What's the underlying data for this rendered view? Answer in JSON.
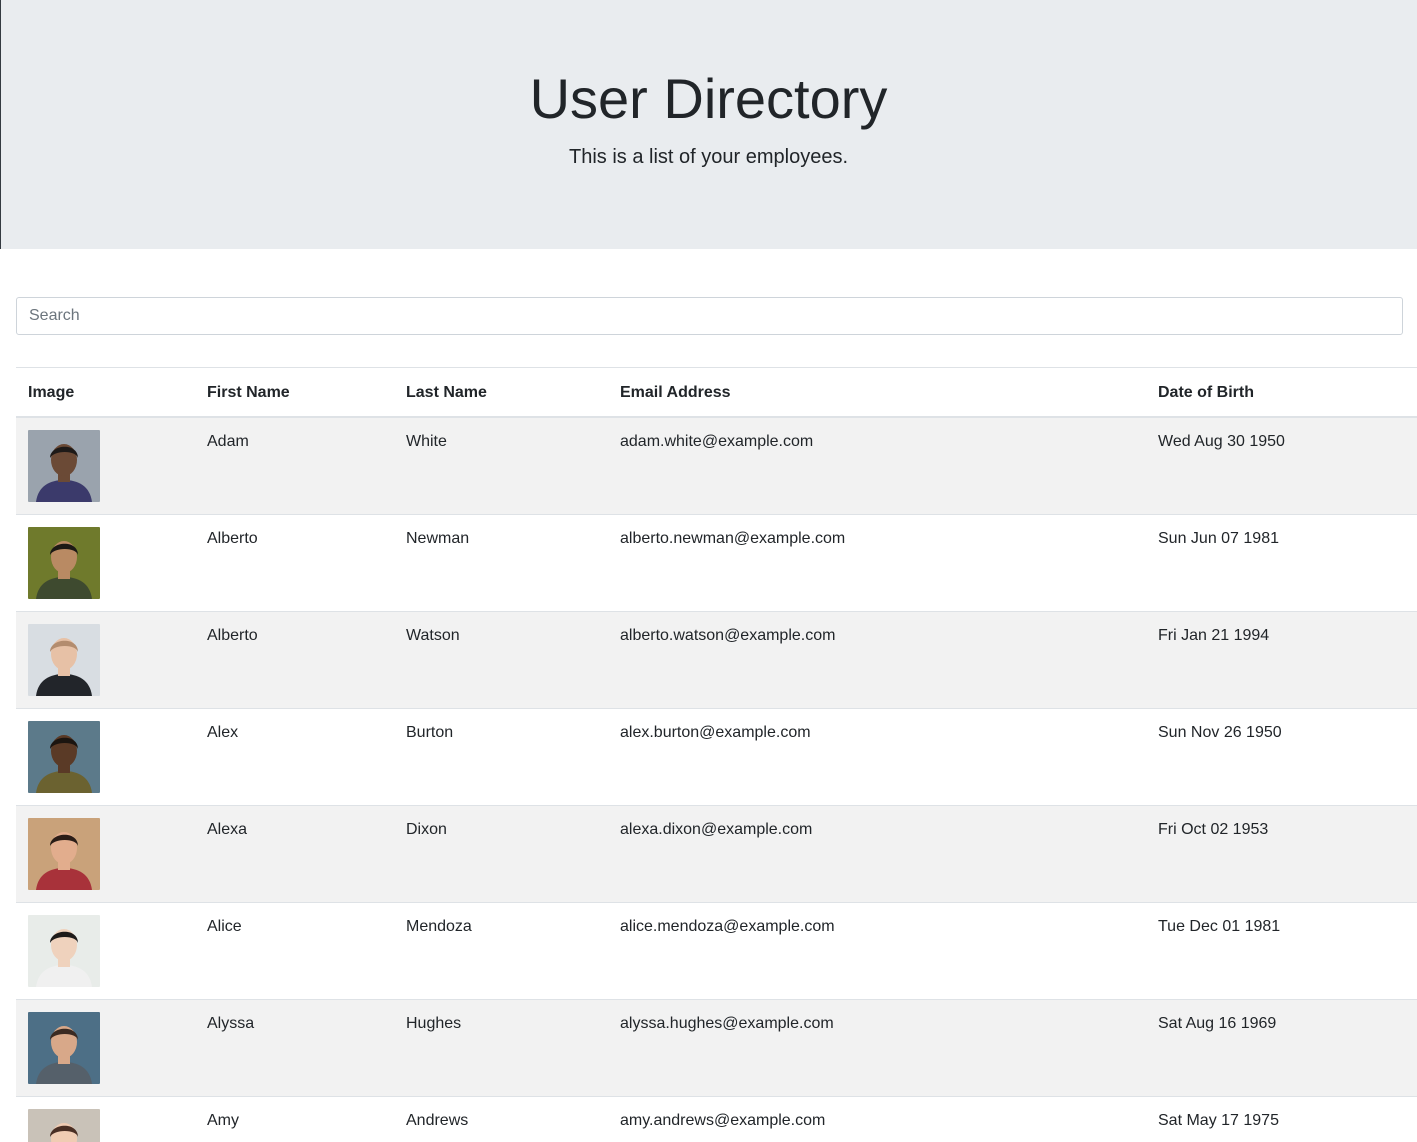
{
  "header": {
    "title": "User Directory",
    "subtitle": "This is a list of your employees."
  },
  "search": {
    "placeholder": "Search",
    "value": ""
  },
  "table": {
    "columns": [
      "Image",
      "First Name",
      "Last Name",
      "Email Address",
      "Date of Birth"
    ],
    "rows": [
      {
        "first": "Adam",
        "last": "White",
        "email": "adam.white@example.com",
        "dob": "Wed Aug 30 1950",
        "avatar": {
          "bg": "#9aa3ad",
          "skin": "#6b4a36",
          "hair": "#1e1a18",
          "shirt": "#3b3a6b"
        }
      },
      {
        "first": "Alberto",
        "last": "Newman",
        "email": "alberto.newman@example.com",
        "dob": "Sun Jun 07 1981",
        "avatar": {
          "bg": "#6f7a2c",
          "skin": "#b98a63",
          "hair": "#1c1915",
          "shirt": "#3e4a2f"
        }
      },
      {
        "first": "Alberto",
        "last": "Watson",
        "email": "alberto.watson@example.com",
        "dob": "Fri Jan 21 1994",
        "avatar": {
          "bg": "#d8dde2",
          "skin": "#e7c1a6",
          "hair": "#b38c6e",
          "shirt": "#22252a"
        }
      },
      {
        "first": "Alex",
        "last": "Burton",
        "email": "alex.burton@example.com",
        "dob": "Sun Nov 26 1950",
        "avatar": {
          "bg": "#5c7a8a",
          "skin": "#5a3a26",
          "hair": "#1b1510",
          "shirt": "#6b6230"
        }
      },
      {
        "first": "Alexa",
        "last": "Dixon",
        "email": "alexa.dixon@example.com",
        "dob": "Fri Oct 02 1953",
        "avatar": {
          "bg": "#c9a27a",
          "skin": "#e2ad8d",
          "hair": "#2a1d17",
          "shirt": "#a8323a"
        }
      },
      {
        "first": "Alice",
        "last": "Mendoza",
        "email": "alice.mendoza@example.com",
        "dob": "Tue Dec 01 1981",
        "avatar": {
          "bg": "#e8ece9",
          "skin": "#efd2bd",
          "hair": "#1d1a19",
          "shirt": "#f0f0f0"
        }
      },
      {
        "first": "Alyssa",
        "last": "Hughes",
        "email": "alyssa.hughes@example.com",
        "dob": "Sat Aug 16 1969",
        "avatar": {
          "bg": "#4d6f86",
          "skin": "#d8a889",
          "hair": "#3a2a22",
          "shirt": "#55606a"
        }
      },
      {
        "first": "Amy",
        "last": "Andrews",
        "email": "amy.andrews@example.com",
        "dob": "Sat May 17 1975",
        "avatar": {
          "bg": "#c9c2b8",
          "skin": "#f0ccb3",
          "hair": "#4a2f24",
          "shirt": "#e8e3de"
        }
      }
    ]
  }
}
